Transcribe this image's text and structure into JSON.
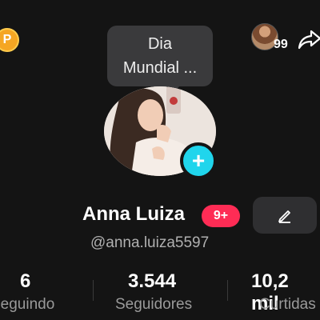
{
  "coin": {
    "label": "P",
    "color": "#f5a623"
  },
  "tooltip": {
    "line1": "Dia",
    "line2": "Mundial ..."
  },
  "friends": {
    "count": "99"
  },
  "profile": {
    "name": "Anna Luiza",
    "badge": "9+",
    "handle": "@anna.luiza5597",
    "add_label": "+"
  },
  "stats": [
    {
      "value": "6",
      "label": "Seguindo"
    },
    {
      "value": "3.544",
      "label": "Seguidores"
    },
    {
      "value": "10,2 mil",
      "label": "Curtidas"
    }
  ],
  "colors": {
    "background": "#141414",
    "accent_cyan": "#20d5ec",
    "badge_red": "#fe2c55",
    "coin_gold": "#f5a623"
  },
  "icons": [
    "coin-icon",
    "share-icon",
    "edit-pen-icon",
    "plus-icon"
  ]
}
